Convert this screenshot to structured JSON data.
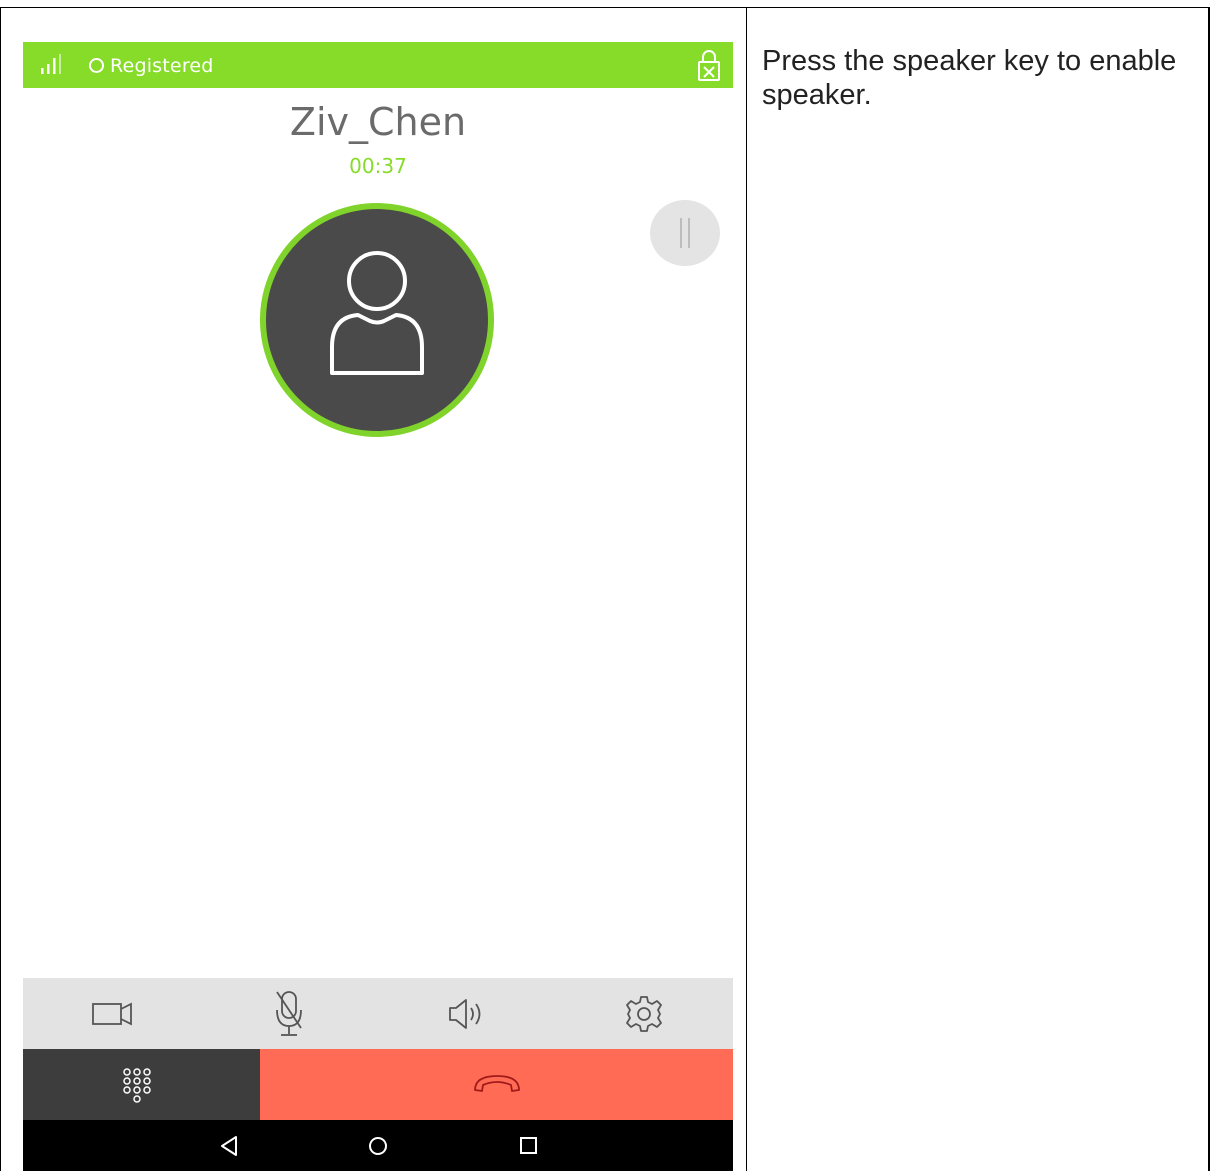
{
  "status_bar": {
    "registration": "Registered",
    "signal_icon": "signal-icon",
    "lock_icon": "lock-icon",
    "background": "#86dc28"
  },
  "call": {
    "caller_name": "Ziv_Chen",
    "duration": "00:37",
    "accent": "#7fd32a"
  },
  "hold_button": {
    "icon": "pause-icon"
  },
  "avatar": {
    "icon": "person-icon",
    "background": "#4a4a4a"
  },
  "toolbar": {
    "items": [
      {
        "icon": "video-icon"
      },
      {
        "icon": "mic-muted-icon"
      },
      {
        "icon": "speaker-icon"
      },
      {
        "icon": "settings-icon"
      }
    ]
  },
  "actions": {
    "dialpad_icon": "dialpad-icon",
    "hangup_icon": "hangup-icon",
    "hangup_color": "#ff6b55"
  },
  "navbar": {
    "back_icon": "back-icon",
    "home_icon": "home-icon",
    "recents_icon": "recents-icon"
  },
  "instruction": {
    "text": "Press the speaker key to enable speaker."
  }
}
